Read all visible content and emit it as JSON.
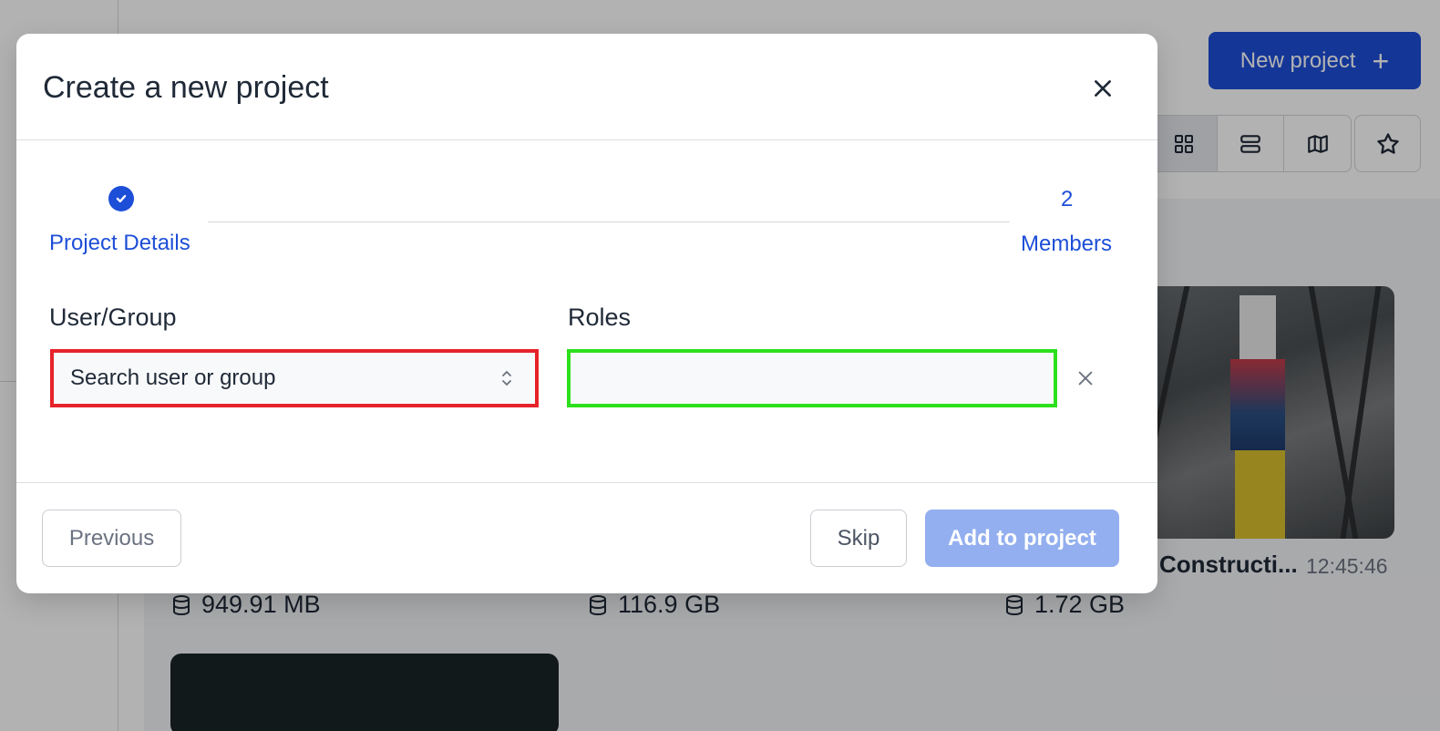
{
  "background": {
    "new_project_label": "New project",
    "card": {
      "title": "Constructi...",
      "time": "12:45:46"
    },
    "sizes": [
      "949.91 MB",
      "116.9 GB",
      "1.72 GB"
    ]
  },
  "modal": {
    "title": "Create a new project",
    "steps": [
      {
        "number": "",
        "label": "Project Details",
        "state": "completed"
      },
      {
        "number": "2",
        "label": "Members",
        "state": "active"
      }
    ],
    "user_group": {
      "label": "User/Group",
      "placeholder": "Search user or group"
    },
    "roles": {
      "label": "Roles",
      "value": ""
    },
    "footer": {
      "previous_label": "Previous",
      "skip_label": "Skip",
      "add_label": "Add to project"
    }
  },
  "colors": {
    "primary": "#1d4ed8",
    "primary_disabled": "#93afef",
    "highlight_red": "#e6232a",
    "highlight_green": "#2ce01c"
  },
  "icons": [
    "plus-icon",
    "grid-view-icon",
    "list-view-icon",
    "map-view-icon",
    "star-icon",
    "close-icon",
    "check-icon",
    "chevron-updown-icon",
    "remove-icon",
    "database-icon"
  ]
}
